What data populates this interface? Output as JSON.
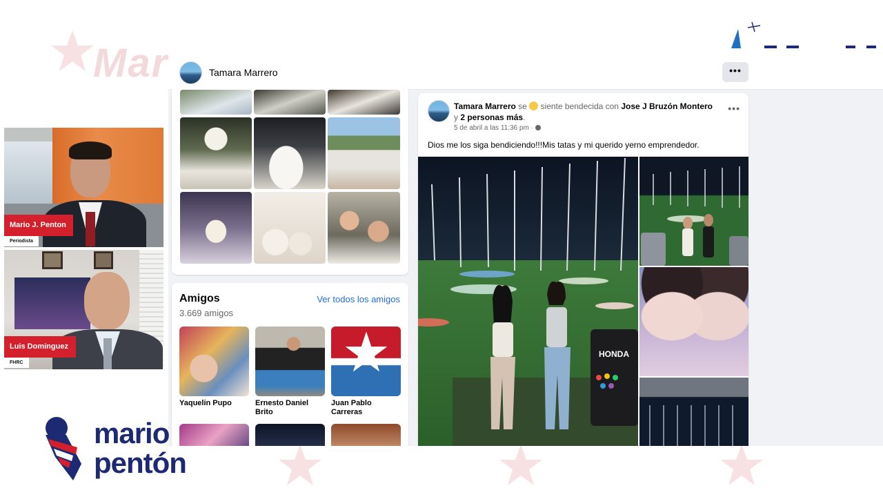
{
  "facebook": {
    "profile_name": "Tamara Marrero",
    "more_label": "•••",
    "friends": {
      "title": "Amigos",
      "count": "3.669 amigos",
      "see_all": "Ver todos los amigos",
      "items": [
        {
          "name": "Yaquelin Pupo"
        },
        {
          "name": "Ernesto Daniel Brito"
        },
        {
          "name": "Juan Pablo Carreras"
        }
      ]
    },
    "post": {
      "author": "Tamara Marrero",
      "feeling_prefix": "se",
      "feeling": "siente bendecida con",
      "tagged": "Jose J Bruzón Montero",
      "conj": "y",
      "others": "2 personas más",
      "period": ".",
      "date": "5 de abril a las 11:36 pm ·",
      "text": "Dios me los siga bendiciendo!!!Mis tatas y mi querido yerno emprendedor.",
      "more_label": "•••"
    }
  },
  "video_panels": [
    {
      "name": "Mario J. Penton",
      "role": "Periodista"
    },
    {
      "name": "Luis Dominguez",
      "role": "FHRC"
    }
  ],
  "brand": {
    "line1": "mario",
    "line2": "pentón"
  },
  "colors": {
    "accent_red": "#d3202c",
    "brand_navy": "#1d2a73",
    "fb_link": "#216fdb"
  }
}
